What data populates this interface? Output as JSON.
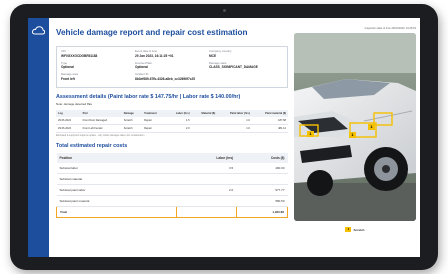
{
  "report": {
    "title": "Vehicle damage report and repair cost estimation",
    "info": {
      "vin_label": "VIN",
      "vin": "WF0GXXGCDGBR51188",
      "event_label": "Event date & time",
      "event": "29 Jan 2023, 16:11:25 +01",
      "country_label": "Company Country",
      "country": "MCE",
      "type_label": "Type",
      "type": "Optional",
      "plate_label": "License Plate",
      "plate": "Optional",
      "damage_state_label": "Damage state",
      "damage_state": "CLASS_SIGNIFICANT_DAMAGE",
      "area_label": "Damage area",
      "area": "Front left",
      "incident_label": "Incident ID",
      "incident": "8b3ef689-67fb-4326-a8eb_cc32696f7c25"
    },
    "assessment": {
      "title": "Assessment details (Paint labor rate $ 147.75/hr | Labor rate $ 140.00/hr)",
      "note_prefix": "Note:",
      "note_label": "damage detected",
      "note_value": "Yes",
      "headers": [
        "Log",
        "Part",
        "Damage",
        "Treatment",
        "Labor (hrs)",
        "Material ($)",
        "Paint labor (hrs)",
        "Paint material ($)"
      ],
      "rows": [
        [
          "29.06.2024",
          "Front Door Damaged",
          "Scratch",
          "Repair",
          "1.5",
          "",
          "1.0",
          "187.68"
        ],
        [
          "29.06.2024",
          "Front Left Fender",
          "Scratch",
          "Repair",
          "2.0",
          "",
          "1.0",
          "481.12"
        ]
      ],
      "footnote": "Estimated & supported repair & replace - only visible damages taken into consideration"
    },
    "costs": {
      "title": "Total estimated repair costs",
      "headers": [
        "Position",
        "Labor (hrs)",
        "Costs ($)"
      ],
      "rows": [
        [
          "Subtotal labor",
          "3.5",
          "490.00"
        ],
        [
          "Subtotal material",
          "",
          ""
        ],
        [
          "Subtotal paint labor",
          "2.0",
          "977.77"
        ],
        [
          "Subtotal paint material",
          "",
          "580.50"
        ],
        [
          "Total",
          "",
          "1,920.86"
        ]
      ]
    }
  },
  "photo": {
    "header": "Inspection date of time 29/01/2023, 16:25:19",
    "legend_marker": "1",
    "legend_label": "Scratch",
    "markers": [
      "1",
      "1",
      "1"
    ]
  },
  "colors": {
    "accent": "#1d4e9e",
    "highlight": "#f5a623",
    "marker": "#f5c000",
    "bezel": "#1b1d21"
  },
  "icons": {
    "app_logo": "cloud-logo-icon"
  }
}
